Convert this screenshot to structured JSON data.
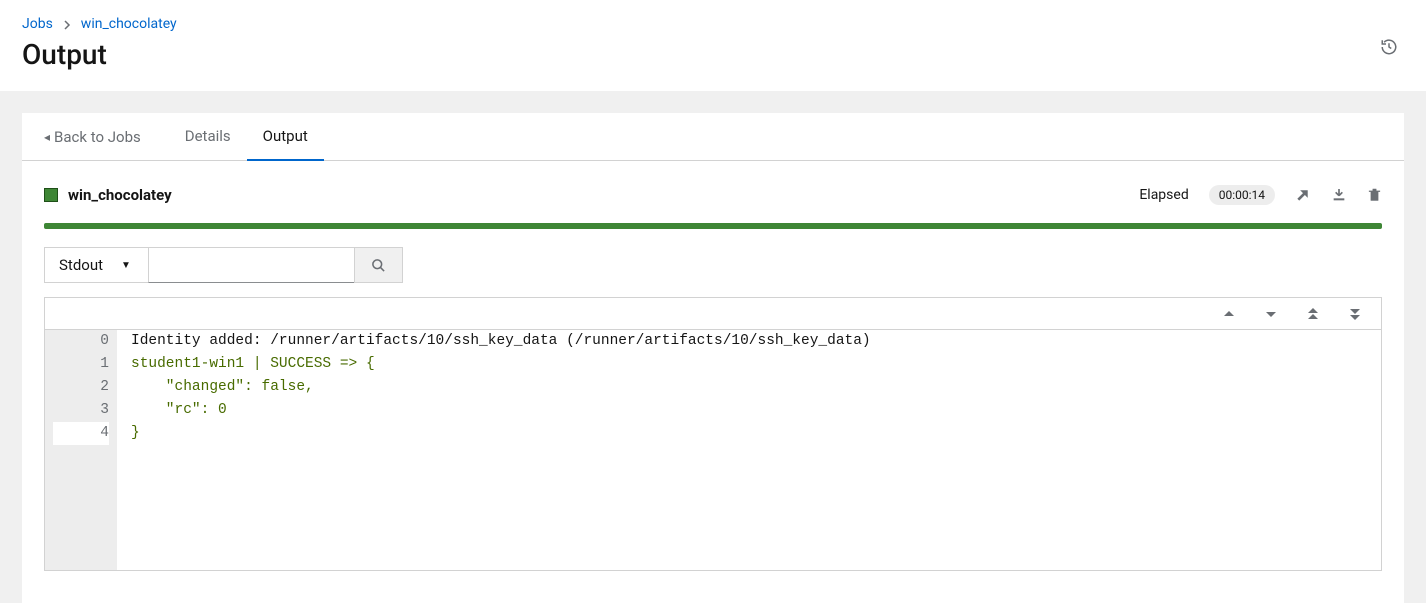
{
  "breadcrumb": {
    "root": "Jobs",
    "current": "win_chocolatey"
  },
  "page_title": "Output",
  "nav": {
    "back_label": "Back to Jobs",
    "tabs": {
      "details": "Details",
      "output": "Output"
    }
  },
  "job": {
    "name": "win_chocolatey",
    "elapsed_label": "Elapsed",
    "elapsed_value": "00:00:14"
  },
  "filter": {
    "mode": "Stdout",
    "search_placeholder": ""
  },
  "output": {
    "lines": [
      {
        "n": "0",
        "text": "Identity added: /runner/artifacts/10/ssh_key_data (/runner/artifacts/10/ssh_key_data)",
        "green": false,
        "hl": false
      },
      {
        "n": "1",
        "text": "student1-win1 | SUCCESS => {",
        "green": true,
        "hl": false
      },
      {
        "n": "2",
        "text": "    \"changed\": false,",
        "green": true,
        "hl": false
      },
      {
        "n": "3",
        "text": "    \"rc\": 0",
        "green": true,
        "hl": false
      },
      {
        "n": "4",
        "text": "}",
        "green": true,
        "hl": true
      }
    ]
  }
}
